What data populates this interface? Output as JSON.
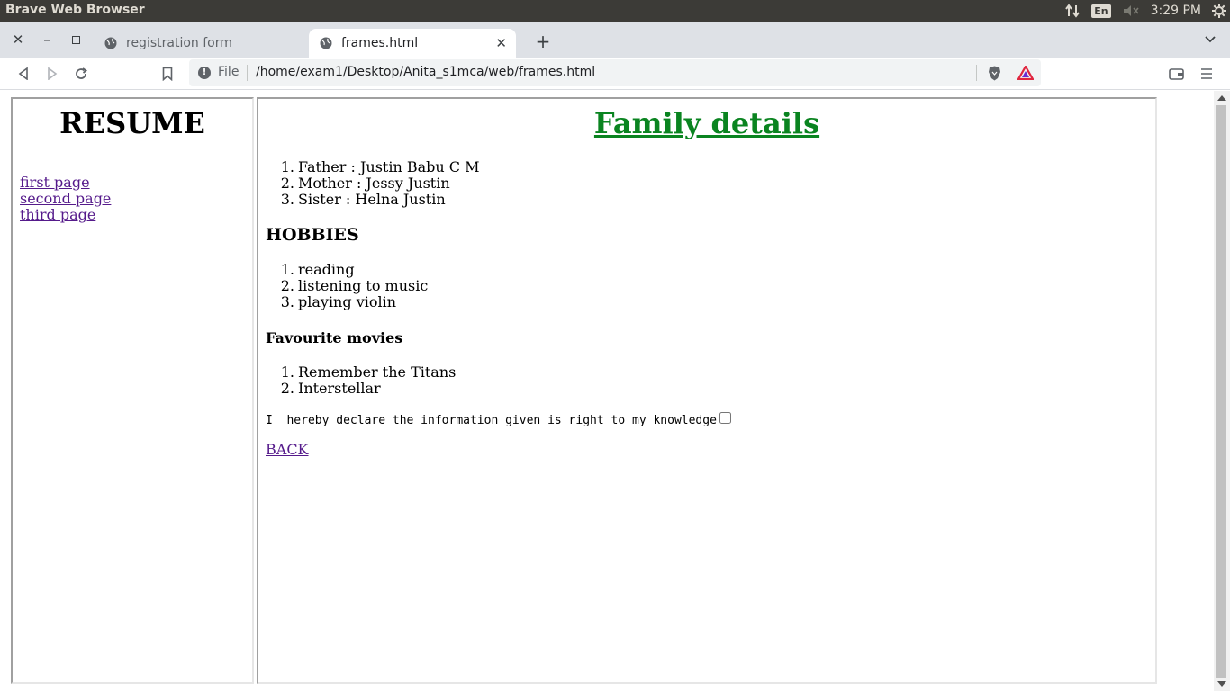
{
  "os": {
    "title": "Brave Web Browser",
    "lang": "En",
    "clock": "3:29 PM"
  },
  "tabs": [
    {
      "label": "registration form"
    },
    {
      "label": "frames.html"
    }
  ],
  "toolbar": {
    "scheme_label": "File",
    "url": "/home/exam1/Desktop/Anita_s1mca/web/frames.html"
  },
  "left_frame": {
    "title": "RESUME",
    "links": [
      "first page",
      "second page",
      "third page"
    ]
  },
  "right_frame": {
    "title": "Family details",
    "family": [
      "Father : Justin Babu C M",
      "Mother : Jessy Justin",
      "Sister : Helna Justin"
    ],
    "hobbies_heading": "HOBBIES",
    "hobbies": [
      "reading",
      "listening to music",
      "playing violin"
    ],
    "movies_heading": "Favourite movies",
    "movies": [
      "Remember the Titans",
      "Interstellar"
    ],
    "declaration": "I  hereby declare the information given is right to my knowledge",
    "declaration_checked": false,
    "back_label": "BACK"
  },
  "colors": {
    "title_green": "#0a8420",
    "link_visited": "#551a8b"
  }
}
